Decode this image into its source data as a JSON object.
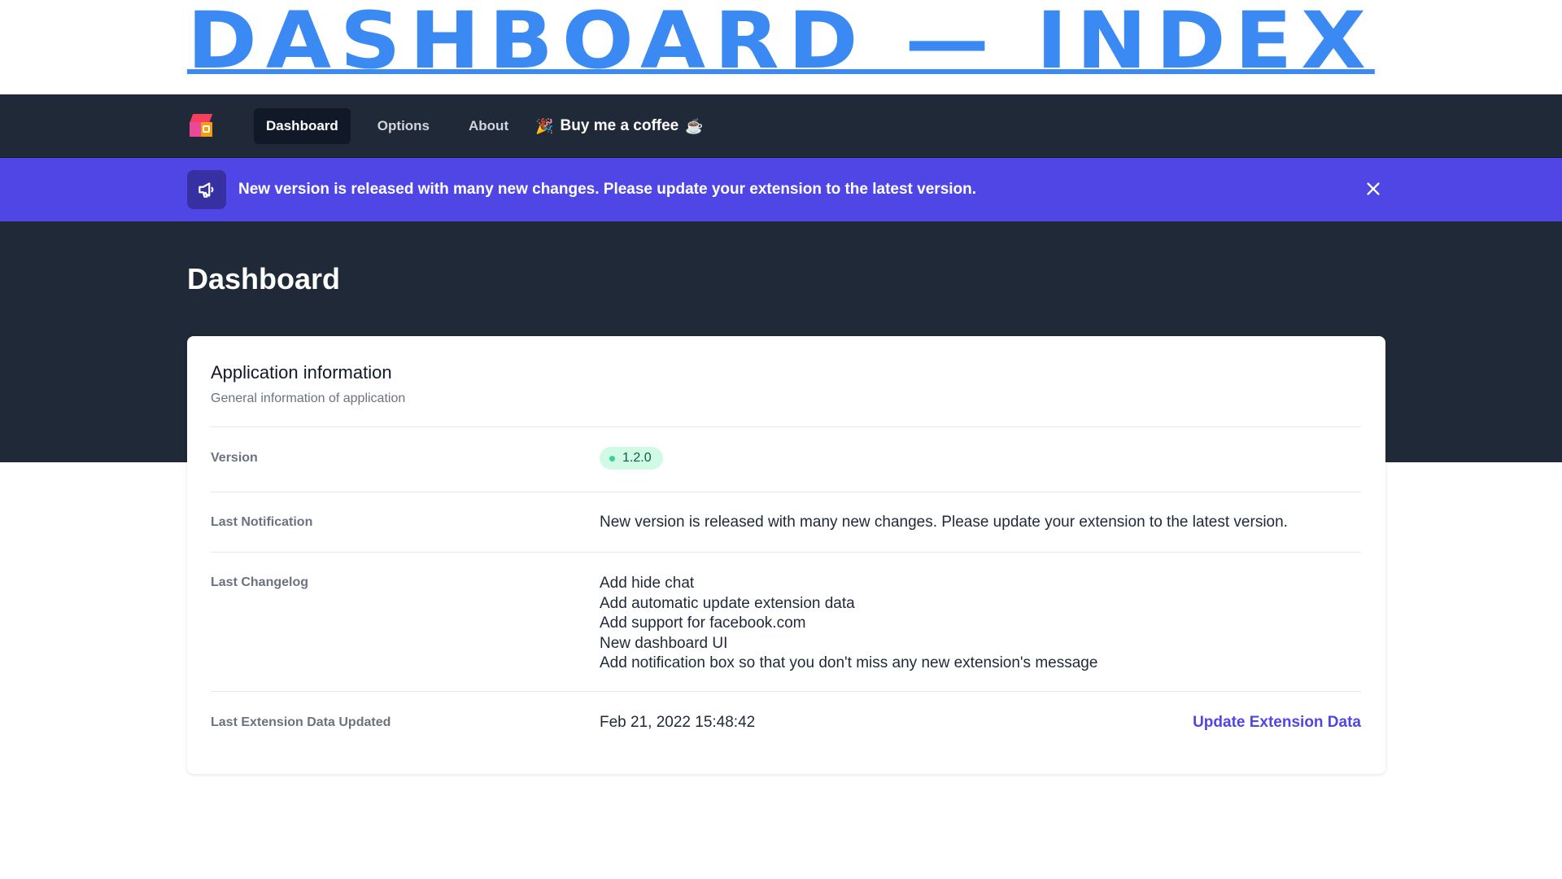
{
  "banner": {
    "title": "DASHBOARD — INDEX"
  },
  "nav": {
    "items": [
      {
        "label": "Dashboard",
        "active": true
      },
      {
        "label": "Options",
        "active": false
      },
      {
        "label": "About",
        "active": false
      }
    ],
    "coffee_label": "Buy me a coffee",
    "coffee_icons": [
      "party-popper-icon",
      "coffee-cup-icon"
    ]
  },
  "notice": {
    "text": "New version is released with many new changes. Please update your extension to the latest version.",
    "icon": "megaphone-icon",
    "close_icon": "close-icon",
    "background": "#4f46e5"
  },
  "page": {
    "title": "Dashboard"
  },
  "card": {
    "title": "Application information",
    "subtitle": "General information of application",
    "rows": {
      "version": {
        "label": "Version",
        "value": "1.2.0"
      },
      "notification": {
        "label": "Last Notification",
        "value": "New version is released with many new changes. Please update your extension to the latest version."
      },
      "changelog": {
        "label": "Last Changelog",
        "items": [
          "Add hide chat",
          "Add automatic update extension data",
          "Add support for facebook.com",
          "New dashboard UI",
          "Add notification box so that you don't miss any new extension's message"
        ]
      },
      "updated": {
        "label": "Last Extension Data Updated",
        "value": "Feb 21, 2022 15:48:42",
        "action_label": "Update Extension Data"
      }
    }
  },
  "colors": {
    "banner_title": "#3b8af4",
    "navbar": "#1f2937",
    "accent": "#4f46e5",
    "badge_bg": "#d1fae5",
    "badge_dot": "#34d399"
  }
}
